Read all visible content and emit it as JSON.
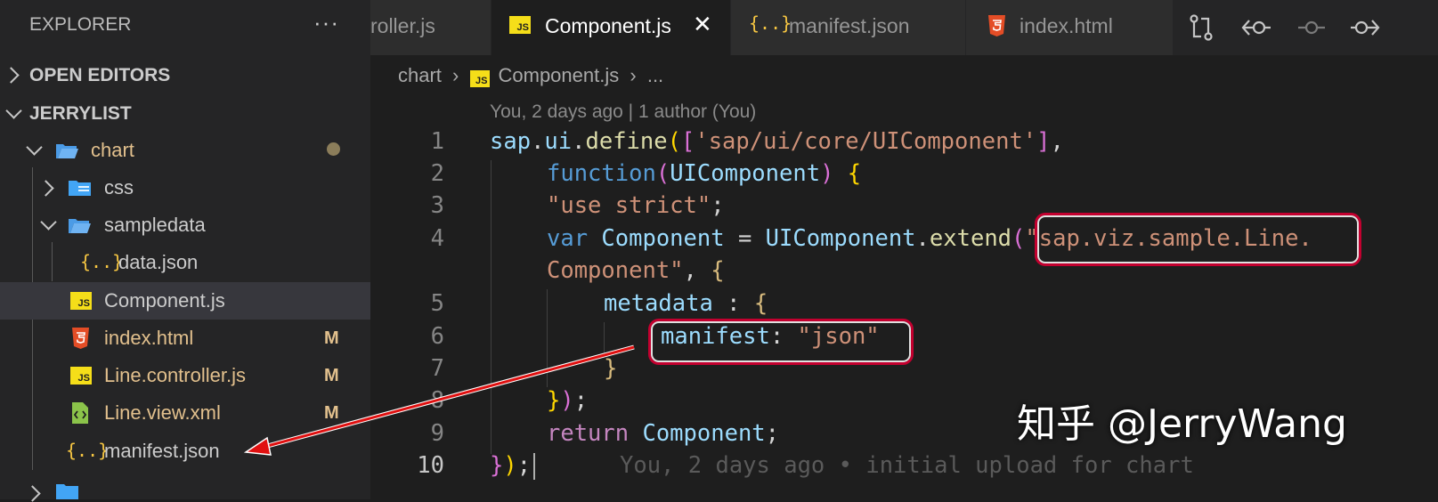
{
  "explorer": {
    "header": "EXPLORER",
    "more": "···",
    "sections": {
      "open_editors": "OPEN EDITORS",
      "workspace": "JERRYLIST"
    },
    "tree": [
      {
        "label": "chart",
        "type": "folder",
        "expanded": true
      },
      {
        "label": "css",
        "type": "folder",
        "expanded": false
      },
      {
        "label": "sampledata",
        "type": "folder",
        "expanded": true
      },
      {
        "label": "data.json",
        "type": "json"
      },
      {
        "label": "Component.js",
        "type": "js",
        "selected": true
      },
      {
        "label": "index.html",
        "type": "html",
        "badge": "M"
      },
      {
        "label": "Line.controller.js",
        "type": "js",
        "badge": "M"
      },
      {
        "label": "Line.view.xml",
        "type": "xml",
        "badge": "M"
      },
      {
        "label": "manifest.json",
        "type": "json"
      }
    ]
  },
  "tabs": [
    {
      "label": "roller.js"
    },
    {
      "label": "Component.js",
      "active": true,
      "icon_text": "JS"
    },
    {
      "label": "manifest.json",
      "icon_text": "{..}"
    },
    {
      "label": "index.html",
      "icon_text": "5"
    }
  ],
  "toolbar_icons": [
    "compare-changes-icon",
    "go-to-previous-change-icon",
    "git-commit-icon",
    "go-to-next-change-icon"
  ],
  "breadcrumb": {
    "folder": "chart",
    "file": "Component.js",
    "ellipsis": "..."
  },
  "blame_header": "You, 2 days ago | 1 author (You)",
  "code": {
    "line_numbers": [
      "1",
      "2",
      "3",
      "4",
      "5",
      "6",
      "7",
      "8",
      "9",
      "10"
    ],
    "l1": {
      "obj": "sap",
      "d1": ".",
      "ui": "ui",
      "d2": ".",
      "define": "define",
      "open": "(",
      "ob": "[",
      "str": "'sap/ui/core/UIComponent'",
      "cb": "]",
      "comma": ","
    },
    "l2": {
      "kw": "function",
      "open": "(",
      "param": "UIComponent",
      "close": ")",
      "brace": " {"
    },
    "l3": {
      "str": "\"use strict\"",
      "semi": ";"
    },
    "l4": {
      "kw": "var",
      "name": " Component",
      "eq": " = ",
      "cls": "UIComponent",
      "dot": ".",
      "fn": "extend",
      "open": "(",
      "str": "\"sap.viz.sample.Line."
    },
    "l4b": {
      "str": "Component\"",
      "rest": ", ",
      "brace": "{"
    },
    "l5": {
      "key": "metadata",
      "colon": " : ",
      "brace": "{"
    },
    "l6": {
      "key": "manifest",
      "colon": ": ",
      "str": "\"json\""
    },
    "l7": {
      "brace": "}"
    },
    "l8": {
      "brace": "}",
      "paren": ")",
      "semi": ";"
    },
    "l9": {
      "kw": "return",
      "name": " Component",
      "semi": ";"
    },
    "l10": {
      "brace": "}",
      "paren": ")",
      "semi": ";"
    }
  },
  "inline_blame": "You, 2 days ago • initial upload for chart",
  "watermark": "知乎 @JerryWang",
  "colors": {
    "highlight": "#c3002f",
    "arrow": "#e01010"
  }
}
